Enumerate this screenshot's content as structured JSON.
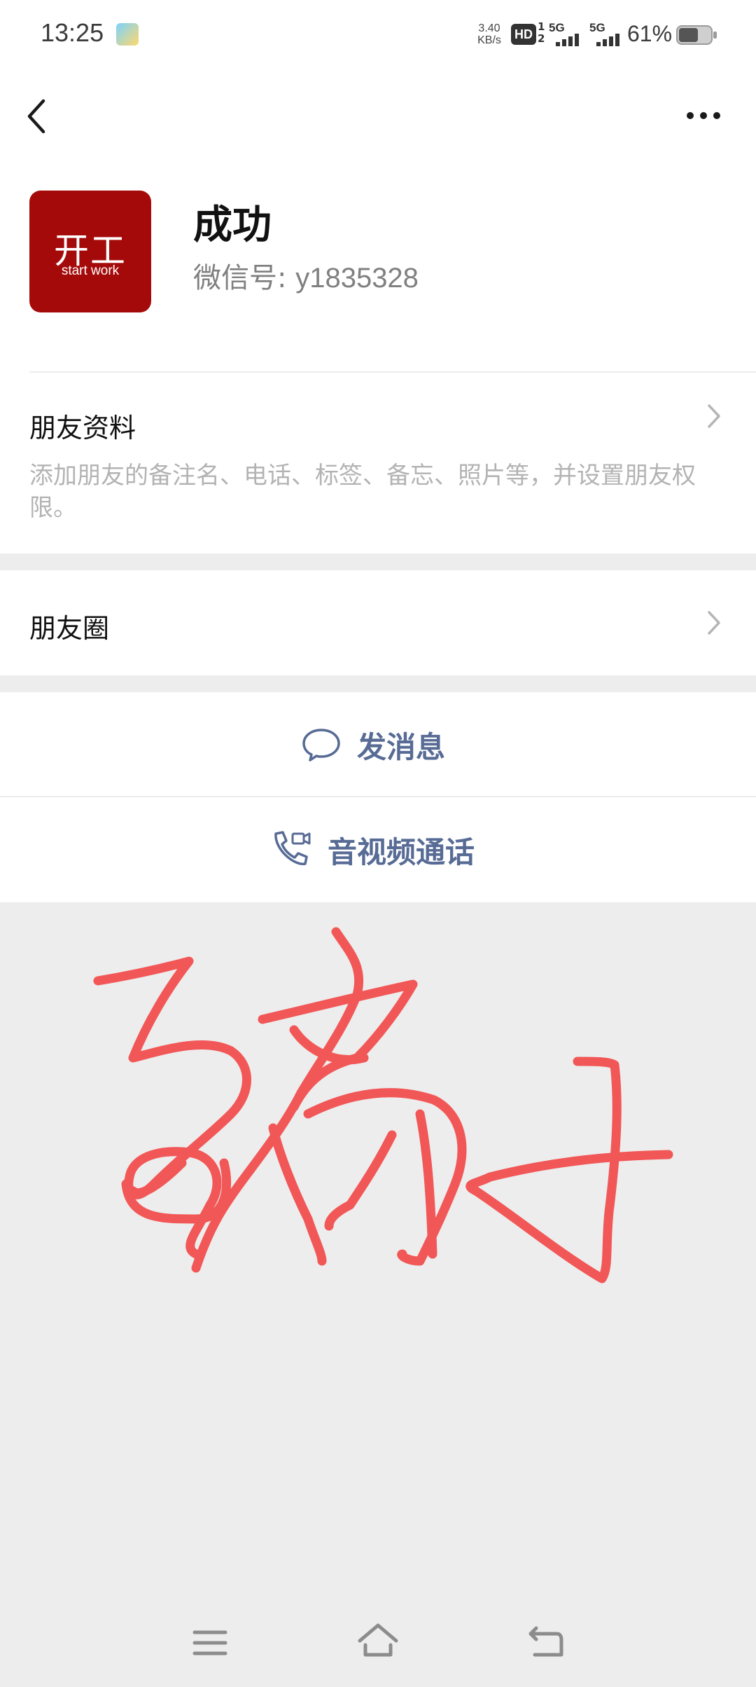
{
  "status_bar": {
    "time": "13:25",
    "net_speed_value": "3.40",
    "net_speed_unit": "KB/s",
    "hd_label": "HD",
    "hd_sim_top": "1",
    "hd_sim_bottom": "2",
    "signal_1_label": "5G",
    "signal_2_label": "5G",
    "battery_percent": "61%",
    "battery_level": 0.61
  },
  "nav_bar": {
    "back_icon": "chevron-left-icon",
    "more_icon": "more-horizontal-icon"
  },
  "profile": {
    "avatar_text_main": "开工",
    "avatar_text_sub": "start work",
    "avatar_color": "#a50a0a",
    "nickname": "成功",
    "wechat_id_label": "微信号:",
    "wechat_id_value": "y1835328"
  },
  "friend_info": {
    "title": "朋友资料",
    "description": "添加朋友的备注名、电话、标签、备忘、照片等，并设置朋友权限。"
  },
  "moments": {
    "title": "朋友圈"
  },
  "actions": {
    "message_label": "发消息",
    "message_icon": "chat-bubble-icon",
    "call_label": "音视频通话",
    "call_icon": "phone-video-icon",
    "accent_color": "#576b95"
  },
  "overlay": {
    "stroke_color": "#f25757"
  }
}
